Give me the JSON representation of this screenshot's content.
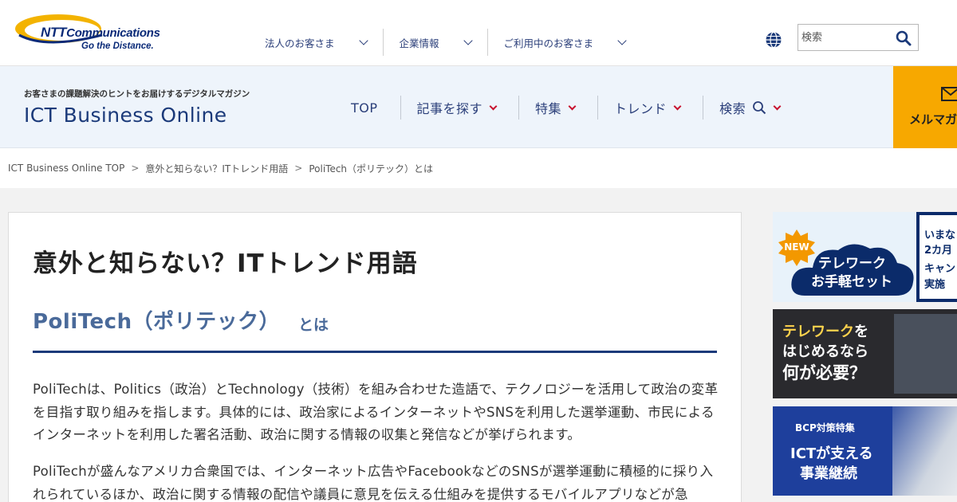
{
  "header": {
    "logo": {
      "line1_bold": "NTT",
      "line1_rest": "Communications",
      "line2": "Go the Distance."
    },
    "corp_nav": [
      {
        "label": "法人のお客さま"
      },
      {
        "label": "企業情報"
      },
      {
        "label": "ご利用中のお客さま"
      }
    ],
    "globe_icon": "globe-icon",
    "search": {
      "placeholder": "検索",
      "value": ""
    }
  },
  "site": {
    "tagline": "お客さまの課題解決のヒントをお届けするデジタルマガジン",
    "brand": "ICT Business Online",
    "nav": [
      {
        "label": "TOP",
        "has_dropdown": false
      },
      {
        "label": "記事を探す",
        "has_dropdown": true
      },
      {
        "label": "特集",
        "has_dropdown": true
      },
      {
        "label": "トレンド",
        "has_dropdown": true
      },
      {
        "label": "検索",
        "has_dropdown": true
      }
    ],
    "mailmag_label": "メルマガ",
    "accent_color": "#f7a800",
    "dropdown_color": "#c8102e",
    "brand_color": "#1b3a7a"
  },
  "breadcrumb": {
    "items": [
      "ICT Business Online TOP",
      "意外と知らない？ITトレンド用語",
      "PoliTech（ポリテック）とは"
    ],
    "separator": ">"
  },
  "article": {
    "title": "意外と知らない？ITトレンド用語",
    "term": "PoliTech（ポリテック）",
    "term_suffix": "とは",
    "paragraphs": [
      "PoliTechは、Politics（政治）とTechnology（技術）を組み合わせた造語で、テクノロジーを活用して政治の変革を目指す取り組みを指します。具体的には、政治家によるインターネットやSNSを利用した選挙運動、市民によるインターネットを利用した署名活動、政治に関する情報の収集と発信などが挙げられます。",
      "PoliTechが盛んなアメリカ合衆国では、インターネット広告やFacebookなどのSNSが選挙運動に積極的に採り入れられているほか、政治に関する情報の配信や議員に意見を伝える仕組みを提供するモバイルアプリなどが急"
    ]
  },
  "sidebar": {
    "banners": [
      {
        "new_label": "NEW",
        "line1": "テレワーク",
        "line2": "お手軽セット",
        "side": [
          "いまな",
          "2カ月",
          "キャン",
          "実施"
        ]
      },
      {
        "line1_hl": "テレワーク",
        "line1_rest": "を",
        "line2": "はじめるなら",
        "line3": "何が必要？"
      },
      {
        "chip": "BCP対策特集",
        "line1": "ICTが支える",
        "line2": "事業継続"
      }
    ]
  }
}
